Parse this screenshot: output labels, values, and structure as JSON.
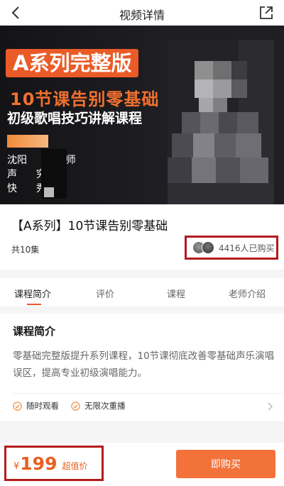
{
  "header": {
    "title": "视频详情",
    "back_icon": "chevron-left-icon",
    "share_icon": "share-icon"
  },
  "banner": {
    "badge": "A系列完整版",
    "headline": "10节课告别零基础",
    "subheadline": "初级歌唱技巧讲解课程",
    "teacher_intro": [
      "沈阳      院教师",
      "声      究专家",
      "快      秀教师"
    ],
    "accent_color": "#ea5b27"
  },
  "course": {
    "title": "【A系列】10节课告别零基础",
    "episodes": "共10集",
    "buyers": "4416人已购买"
  },
  "tabs": [
    {
      "label": "课程简介",
      "active": true
    },
    {
      "label": "评价",
      "active": false
    },
    {
      "label": "课程",
      "active": false
    },
    {
      "label": "老师介绍",
      "active": false
    }
  ],
  "intro": {
    "heading": "课程简介",
    "description": "零基础完整版提升系列课程，10节课彻底改善零基础声乐演唱误区，提高专业初级演唱能力。",
    "features": [
      "随时观看",
      "无限次重播"
    ]
  },
  "purchase": {
    "currency": "¥",
    "price": "199",
    "price_label": "超值价",
    "buy_label": "即购买",
    "price_color": "#e85f21"
  }
}
